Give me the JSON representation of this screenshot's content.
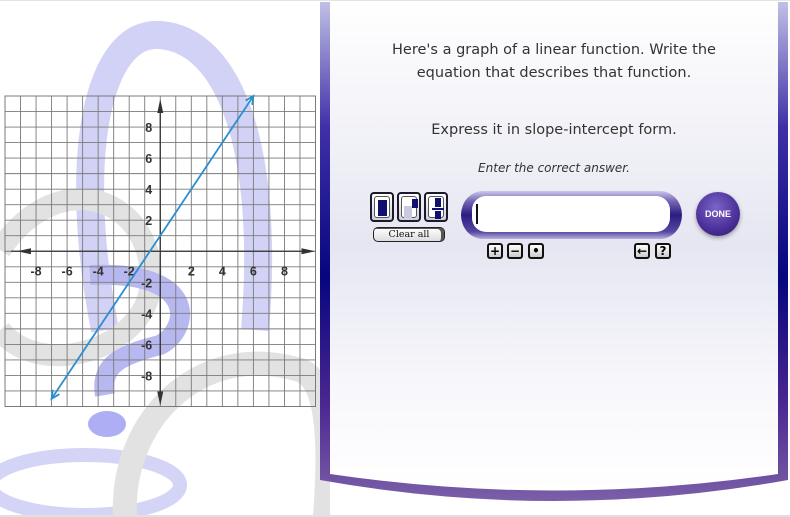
{
  "question": {
    "line1": "Here's a graph of a linear function. Write the",
    "line2": "equation that describes that function.",
    "instruction": "Express it in slope-intercept form.",
    "hint": "Enter the correct answer."
  },
  "editor": {
    "template_buttons": [
      "fraction-template",
      "exponent-template",
      "fraction-bar-template"
    ],
    "clear_all_label": "Clear all",
    "answer_value": "",
    "sign_buttons": [
      "+",
      "−",
      "•"
    ],
    "backspace_label": "←",
    "help_label": "?",
    "done_label": "DONE"
  },
  "colors": {
    "line": "#2a8fcf",
    "frame_dark": "#1e0f7a",
    "frame_light": "#7b5fa8"
  },
  "chart_data": {
    "type": "line",
    "title": "",
    "xlabel": "",
    "ylabel": "",
    "xlim": [
      -10,
      10
    ],
    "ylim": [
      -10,
      10
    ],
    "grid": true,
    "grid_step": 1,
    "x_ticks": [
      -8,
      -6,
      -4,
      -2,
      2,
      4,
      6,
      8
    ],
    "y_ticks": [
      8,
      6,
      4,
      2,
      -2,
      -4,
      -6,
      -8
    ],
    "series": [
      {
        "name": "linear function",
        "slope": 1.5,
        "intercept": 1,
        "x": [
          -7,
          6
        ],
        "y": [
          -9.5,
          10
        ],
        "arrows_both_ends": true
      }
    ]
  }
}
